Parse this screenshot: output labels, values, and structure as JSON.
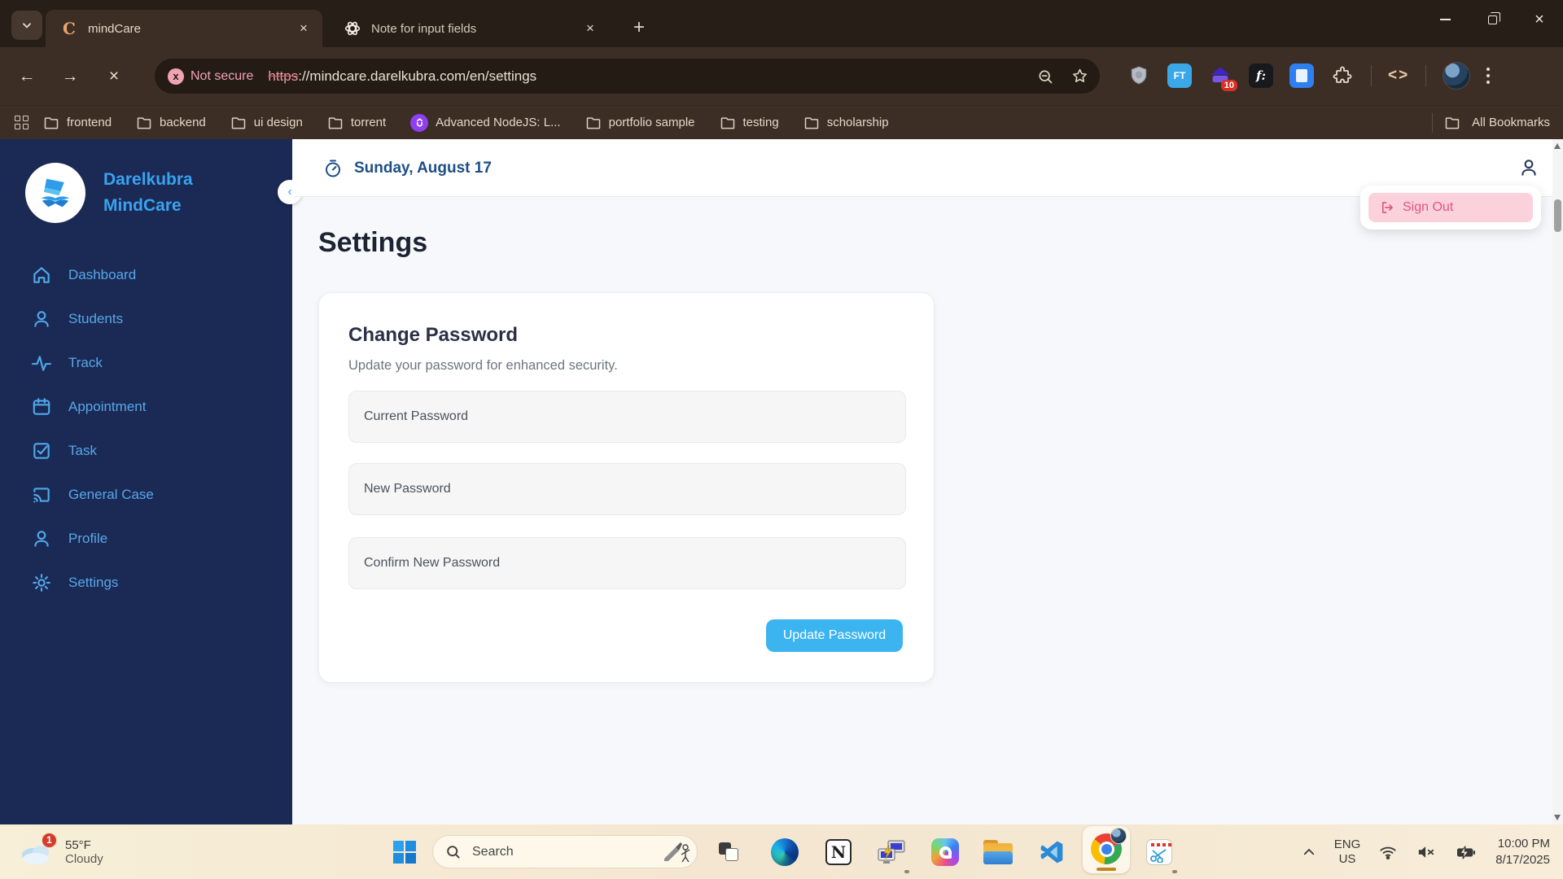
{
  "glyphs": {
    "tab_caret": "⌄",
    "close_x": "×",
    "new_tab_plus": "+",
    "back_arrow": "←",
    "forward_arrow": "→",
    "stop_x": "×",
    "code_brackets": "<>",
    "collapse_chevron": "‹",
    "notion_n": "N",
    "ft_ext": "FT",
    "fontface_ext": "f:"
  },
  "browser": {
    "tabs": [
      {
        "title": "mindCare",
        "favicon_letter": "C"
      },
      {
        "title": "Note for input fields"
      }
    ],
    "address": {
      "security_chip": "Not secure",
      "security_dot": "x",
      "url_scheme": "https",
      "url_rest": "://mindcare.darelkubra.com/en/settings"
    },
    "extension_badge": "10",
    "bookmarks": [
      {
        "label": "frontend"
      },
      {
        "label": "backend"
      },
      {
        "label": "ui design"
      },
      {
        "label": "torrent"
      },
      {
        "label": "Advanced NodeJS: L..."
      },
      {
        "label": "portfolio sample"
      },
      {
        "label": "testing"
      },
      {
        "label": "scholarship"
      }
    ],
    "all_bookmarks": "All Bookmarks"
  },
  "sidebar": {
    "brand_line1": "Darelkubra",
    "brand_line2": "MindCare",
    "items": [
      {
        "label": "Dashboard"
      },
      {
        "label": "Students"
      },
      {
        "label": "Track"
      },
      {
        "label": "Appointment"
      },
      {
        "label": "Task"
      },
      {
        "label": "General Case"
      },
      {
        "label": "Profile"
      },
      {
        "label": "Settings"
      }
    ]
  },
  "header": {
    "date": "Sunday, August 17"
  },
  "user_menu": {
    "sign_out": "Sign Out"
  },
  "page": {
    "title": "Settings",
    "card": {
      "title": "Change Password",
      "subtitle": "Update your password for enhanced security.",
      "fields": [
        {
          "placeholder": "Current Password"
        },
        {
          "placeholder": "New Password"
        },
        {
          "placeholder": "Confirm New Password"
        }
      ],
      "submit": "Update Password"
    }
  },
  "taskbar": {
    "weather": {
      "badge": "1",
      "temperature": "55°F",
      "condition": "Cloudy"
    },
    "search": {
      "placeholder": "Search"
    },
    "tray": {
      "language": "ENG",
      "region": "US",
      "time": "10:00 PM",
      "date": "8/17/2025"
    }
  },
  "colors": {
    "accent_blue": "#3cb4f0",
    "sidebar_navy": "#1b2955",
    "signout_pink": "#e4547c",
    "taskbar_cream": "#f6ebd5"
  }
}
